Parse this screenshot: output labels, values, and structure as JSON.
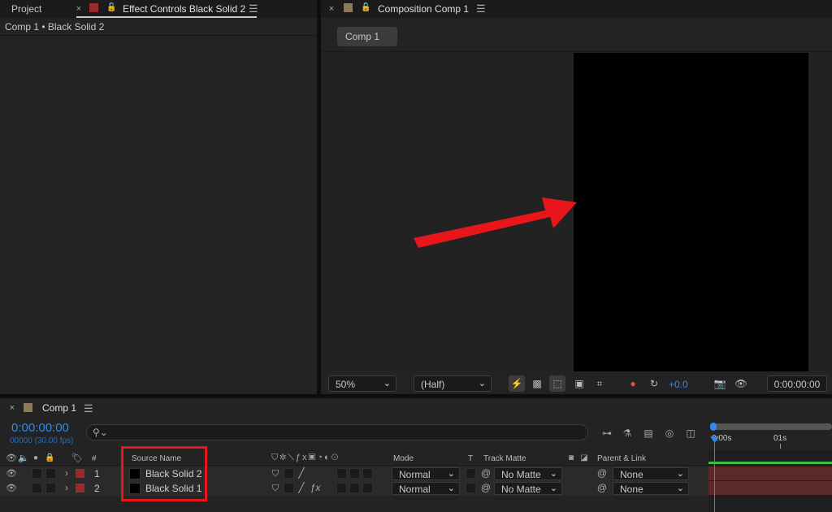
{
  "left_panel": {
    "tab_project": "Project",
    "tab_effect_controls": "Effect Controls Black Solid 2",
    "breadcrumb": "Comp 1 • Black Solid 2"
  },
  "viewer": {
    "tab_title": "Composition Comp 1",
    "comp_button": "Comp 1",
    "zoom": "50%",
    "resolution": "(Half)",
    "exposure": "+0.0",
    "timecode": "0:00:00:00"
  },
  "timeline": {
    "tab_title": "Comp 1",
    "timecode": "0:00:00:00",
    "frame_info": "00000 (30.00 fps)",
    "ruler_start": "0:00s",
    "ruler_mark": "01s",
    "columns": {
      "number": "#",
      "source_name": "Source Name",
      "mode": "Mode",
      "t": "T",
      "track_matte": "Track Matte",
      "parent_link": "Parent & Link"
    },
    "layers": [
      {
        "index": "1",
        "name": "Black Solid 2",
        "mode": "Normal",
        "matte": "No Matte",
        "parent": "None",
        "fx": false
      },
      {
        "index": "2",
        "name": "Black Solid 1",
        "mode": "Normal",
        "matte": "No Matte",
        "parent": "None",
        "fx": true
      }
    ]
  },
  "colors": {
    "accent_blue": "#2d8ceb",
    "label_red": "#9b2a2a",
    "highlight_red": "#e8161b",
    "track_bar": "#5a2a2a",
    "comp_swatch": "#8a7a5a"
  }
}
